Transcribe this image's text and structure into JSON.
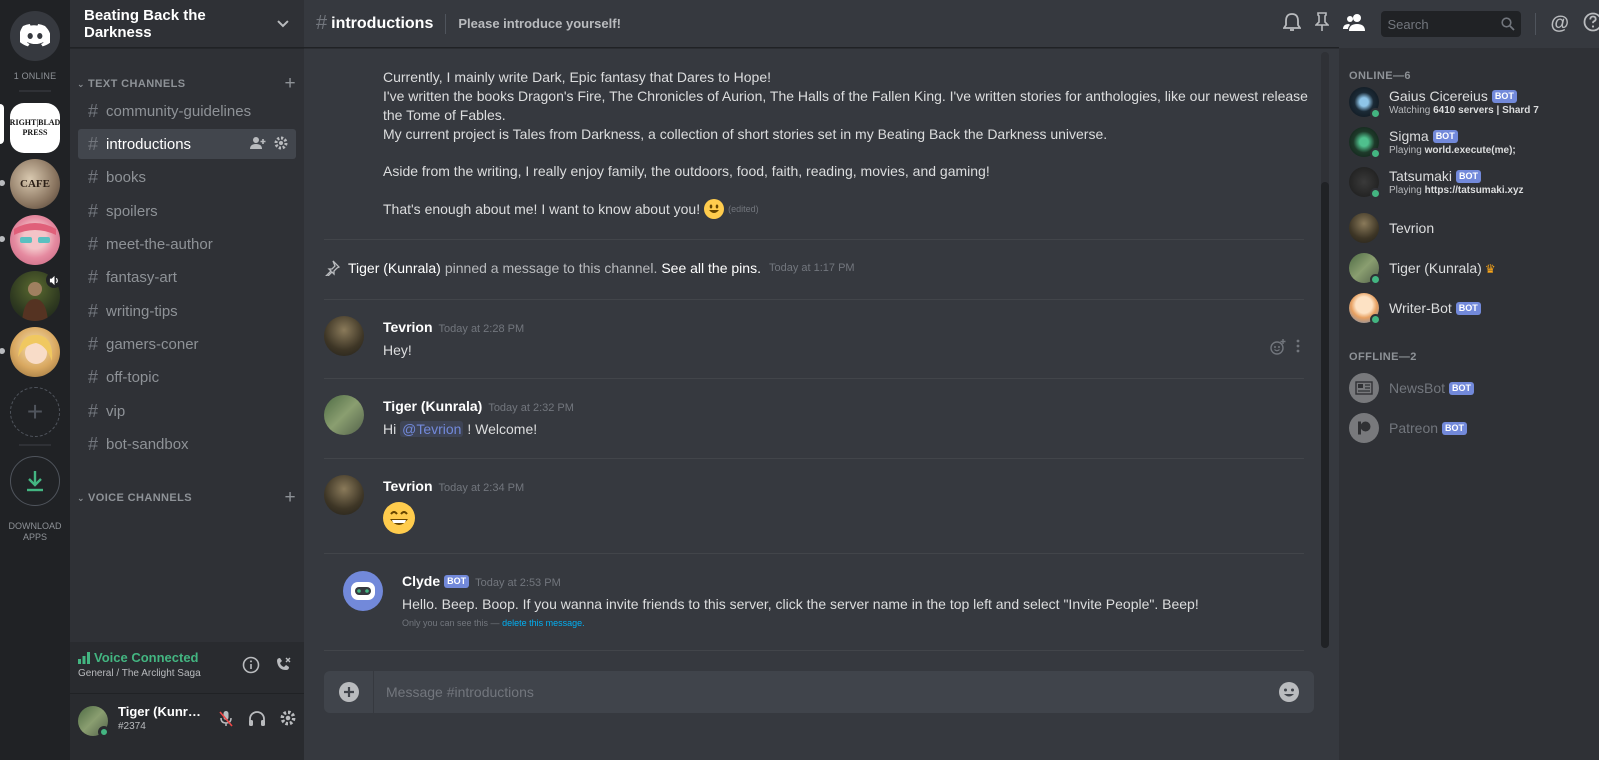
{
  "rail": {
    "online_label": "1 ONLINE",
    "download_label_line1": "DOWNLOAD",
    "download_label_line2": "APPS",
    "servers": [
      {
        "name": "Brightblade Press",
        "initials": "RIGHT|BLAD PRESS"
      },
      {
        "name": "Cafe server",
        "initials": "CAFE"
      },
      {
        "name": "Anime server",
        "initials": ""
      },
      {
        "name": "Warrior server",
        "initials": ""
      },
      {
        "name": "Blonde character server",
        "initials": ""
      }
    ]
  },
  "guild": {
    "name": "Beating Back the Darkness"
  },
  "categories": {
    "text": "TEXT CHANNELS",
    "voice": "VOICE CHANNELS"
  },
  "channels": [
    {
      "name": "community-guidelines"
    },
    {
      "name": "introductions"
    },
    {
      "name": "books"
    },
    {
      "name": "spoilers"
    },
    {
      "name": "meet-the-author"
    },
    {
      "name": "fantasy-art"
    },
    {
      "name": "writing-tips"
    },
    {
      "name": "gamers-coner"
    },
    {
      "name": "off-topic"
    },
    {
      "name": "vip"
    },
    {
      "name": "bot-sandbox"
    }
  ],
  "voice": {
    "status": "Voice Connected",
    "location": "General / The Arclight Saga"
  },
  "user": {
    "name": "Tiger (Kunra...",
    "tag": "#2374"
  },
  "header": {
    "channel": "introductions",
    "topic": "Please introduce yourself!",
    "search_placeholder": "Search"
  },
  "messages": {
    "intro_lines": [
      "Currently, I mainly write Dark, Epic fantasy that Dares to Hope!",
      "I've written the books Dragon's Fire, The Chronicles of Aurion, The Halls of the Fallen King. I've written stories for anthologies, like our newest release",
      "the Tome of Fables.",
      "My current project is Tales from Darkness, a collection of short stories set in my Beating Back the Darkness universe.",
      "Aside from the writing, I really enjoy family, the outdoors, food, faith, reading, movies, and gaming!",
      "That's enough about me! I want to know about you!"
    ],
    "edited": "(edited)",
    "pin": {
      "user": "Tiger (Kunrala)",
      "text": "pinned a message to this channel.",
      "link": "See all the pins.",
      "time": "Today at 1:17 PM"
    },
    "m1": {
      "author": "Tevrion",
      "time": "Today at 2:28 PM",
      "text": "Hey!"
    },
    "m2": {
      "author": "Tiger (Kunrala)",
      "time": "Today at 2:32 PM",
      "pre": "Hi",
      "mention": "@Tevrion",
      "post": "! Welcome!"
    },
    "m3": {
      "author": "Tevrion",
      "time": "Today at 2:34 PM",
      "emoji": "😄"
    },
    "m4": {
      "author": "Clyde",
      "bot": "BOT",
      "time": "Today at 2:53 PM",
      "text": "Hello. Beep. Boop. If you wanna invite friends to this server, click the server name in the top left and select \"Invite People\". Beep!",
      "note": "Only you can see this —",
      "note_link": "delete this message."
    }
  },
  "composer": {
    "placeholder": "Message #introductions"
  },
  "members": {
    "online_header": "ONLINE—6",
    "offline_header": "OFFLINE—2",
    "online": [
      {
        "name": "Gaius Cicereius",
        "bot": "BOT",
        "act_prefix": "Watching",
        "act": "6410 servers | Shard 7",
        "color": "#1b2a36"
      },
      {
        "name": "Sigma",
        "bot": "BOT",
        "act_prefix": "Playing",
        "act": "world.execute(me);",
        "color": "#1e3a2a"
      },
      {
        "name": "Tatsumaki",
        "bot": "BOT",
        "act_prefix": "Playing",
        "act": "https://tatsumaki.xyz",
        "color": "#2a2a2a"
      },
      {
        "name": "Tevrion",
        "color": "#4a4030"
      },
      {
        "name": "Tiger (Kunrala)",
        "crown": "♛",
        "color": "#4e6b44"
      },
      {
        "name": "Writer-Bot",
        "bot": "BOT",
        "color": "#e8a060"
      }
    ],
    "offline": [
      {
        "name": "NewsBot",
        "bot": "BOT"
      },
      {
        "name": "Patreon",
        "bot": "BOT"
      }
    ]
  },
  "colors": {
    "accent": "#7289da",
    "online": "#43b581",
    "link": "#00b0f4"
  }
}
